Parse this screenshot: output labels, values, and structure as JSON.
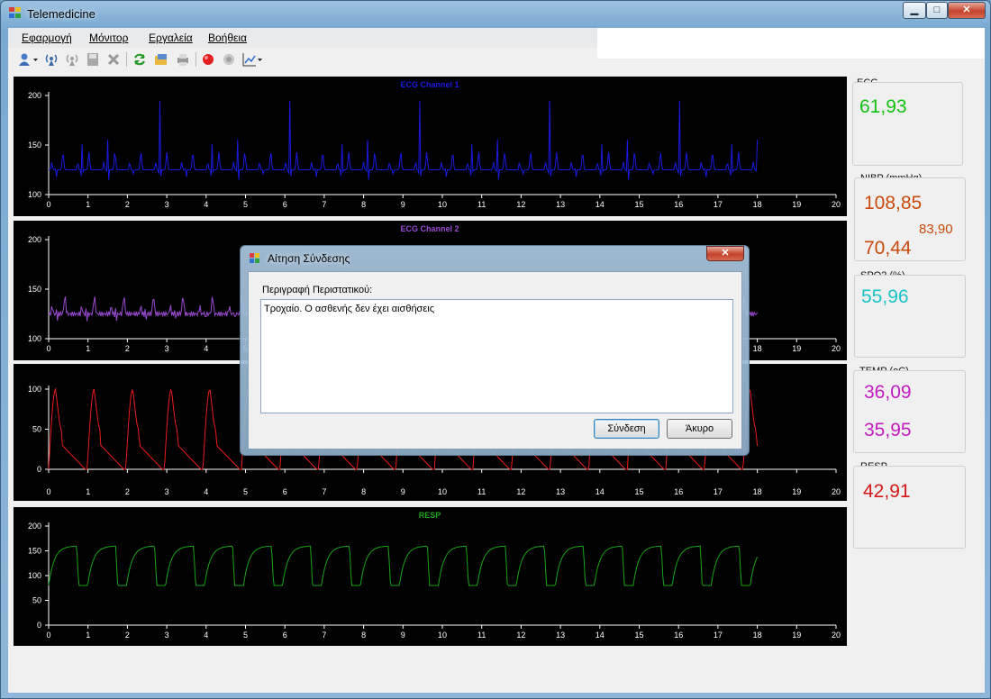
{
  "window": {
    "title": "Telemedicine",
    "buttons": {
      "minimize": "▁",
      "maximize": "□",
      "close": "✕"
    }
  },
  "menu": [
    "Εφαρμογή",
    "Μόνιτορ",
    "Εργαλεία",
    "Βοήθεια"
  ],
  "toolbar": {
    "icons": [
      "user-dropdown-icon",
      "connect-antenna-icon",
      "disconnect-antenna-icon",
      "save-icon",
      "settings-icon",
      "refresh-icon",
      "open-folder-icon",
      "print-icon",
      "record-icon",
      "stop-icon",
      "chart-dropdown-icon"
    ]
  },
  "charts": [
    {
      "title": "ECG Channel 1",
      "color": "#1a1ae0",
      "yticks": [
        100,
        150,
        200
      ]
    },
    {
      "title": "ECG Channel 2",
      "color": "#9a4ad0",
      "yticks": [
        100,
        150,
        200
      ]
    },
    {
      "title": "",
      "color": "#ee1c1c",
      "yticks": [
        0,
        50,
        100
      ]
    },
    {
      "title": "RESP",
      "color": "#19a319",
      "yticks": [
        0,
        50,
        100,
        150,
        200
      ]
    }
  ],
  "xticks": [
    0,
    1,
    2,
    3,
    4,
    5,
    6,
    7,
    8,
    9,
    10,
    11,
    12,
    13,
    14,
    15,
    16,
    17,
    18,
    19,
    20
  ],
  "panels": {
    "ecg": {
      "label": "ECG",
      "value": "61,93",
      "color": "#12c012"
    },
    "nibp": {
      "label": "NIBP (mmHg)",
      "systolic": "108,85",
      "mean": "83,90",
      "diastolic": "70,44",
      "color": "#c84a0c"
    },
    "spo2": {
      "label": "SPO2 (%)",
      "value": "55,96",
      "color": "#1ac4c4"
    },
    "temp": {
      "label": "TEMP (oC)",
      "value1": "36,09",
      "value2": "35,95",
      "color": "#c41ac4"
    },
    "resp": {
      "label": "RESP",
      "value": "42,91",
      "color": "#d41818"
    }
  },
  "dialog": {
    "title": "Αίτηση Σύνδεσης",
    "field_label": "Περιγραφή Περιστατικού:",
    "text": "Τροχαίο. Ο ασθενής δεν έχει αισθήσεις",
    "ok_label": "Σύνδεση",
    "cancel_label": "Άκυρο"
  }
}
